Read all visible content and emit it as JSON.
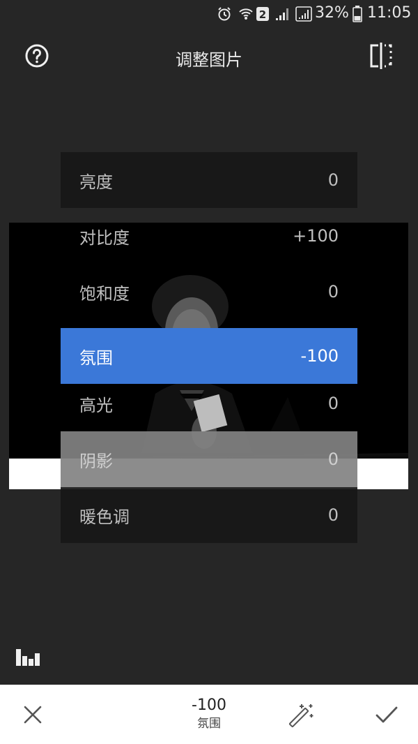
{
  "status_bar": {
    "battery_percent": "32%",
    "time": "11:05",
    "sim_badge": "2",
    "icons": [
      "alarm-icon",
      "wifi-icon",
      "sim-2-icon",
      "signal-icon",
      "signal-icon",
      "battery-icon"
    ]
  },
  "header": {
    "title": "调整图片",
    "help_icon": "help-circle-icon",
    "compare_icon": "compare-split-icon"
  },
  "adjust_menu": {
    "items": [
      {
        "label": "亮度",
        "value": "0"
      },
      {
        "label": "对比度",
        "value": "+100"
      },
      {
        "label": "饱和度",
        "value": "0"
      },
      {
        "label": "氛围",
        "value": "-100",
        "selected": true
      },
      {
        "label": "高光",
        "value": "0"
      },
      {
        "label": "阴影",
        "value": "0"
      },
      {
        "label": "暖色调",
        "value": "0"
      }
    ],
    "selected_color": "#3b78d8"
  },
  "histogram_icon": "histogram-icon",
  "bottom_bar": {
    "current_value": "-100",
    "current_label": "氛围",
    "cancel_icon": "close-icon",
    "auto_icon": "magic-wand-icon",
    "confirm_icon": "check-icon"
  }
}
